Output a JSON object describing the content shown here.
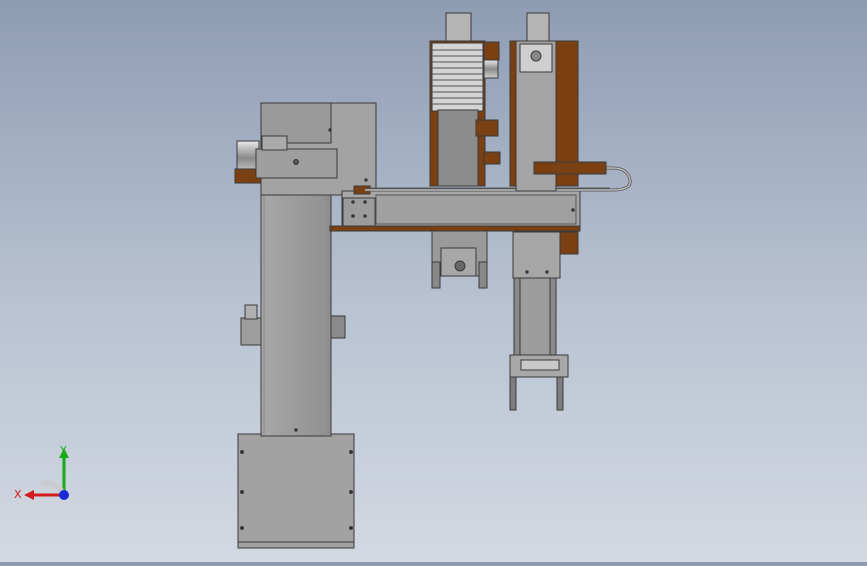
{
  "viewport": {
    "background_top": "#8e9cb3",
    "background_bottom": "#d3d9e2"
  },
  "colors": {
    "steel": "#9c9c9c",
    "steel_light": "#b2b2b2",
    "steel_dark": "#7d7d7d",
    "bronze": "#7a4012",
    "edge": "#3a3a3a"
  },
  "triad": {
    "x_label": "X",
    "y_label": "Y",
    "x_color": "#d11c1c",
    "y_color": "#18a818",
    "z_color": "#1a2ad8"
  }
}
